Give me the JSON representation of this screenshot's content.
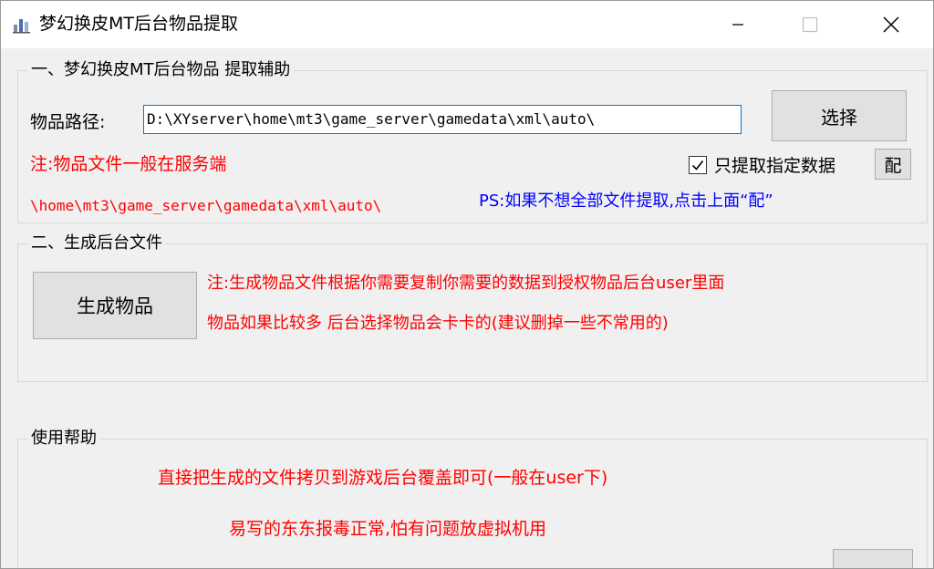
{
  "window": {
    "title": "梦幻换皮MT后台物品提取"
  },
  "group_extract": {
    "title": "一、梦幻换皮MT后台物品 提取辅助",
    "path_label": "物品路径:",
    "path_value": "D:\\XYserver\\home\\mt3\\game_server\\gamedata\\xml\\auto\\",
    "select_button": "选择",
    "checkbox_label": "只提取指定数据",
    "checkbox_checked": true,
    "config_button": "配",
    "note_line1": "注:物品文件一般在服务端",
    "note_line2": "\\home\\mt3\\game_server\\gamedata\\xml\\auto\\",
    "ps_note": "PS:如果不想全部文件提取,点击上面“配”"
  },
  "group_generate": {
    "title": "二、生成后台文件",
    "generate_button": "生成物品",
    "note_line1": "注:生成物品文件根据你需要复制你需要的数据到授权物品后台user里面",
    "note_line2": "物品如果比较多 后台选择物品会卡卡的(建议删掉一些不常用的)"
  },
  "group_help": {
    "title": "使用帮助",
    "line1": "直接把生成的文件拷贝到游戏后台覆盖即可(一般在user下)",
    "line2": "易写的东东报毒正常,怕有问题放虚拟机用"
  },
  "colors": {
    "note_red": "#ff0000",
    "ps_blue": "#0000ff",
    "input_border": "#0078d7"
  },
  "icons": {
    "app": "app-icon",
    "minimize": "minimize-icon",
    "maximize": "maximize-icon",
    "close": "close-icon",
    "check": "check-icon"
  }
}
